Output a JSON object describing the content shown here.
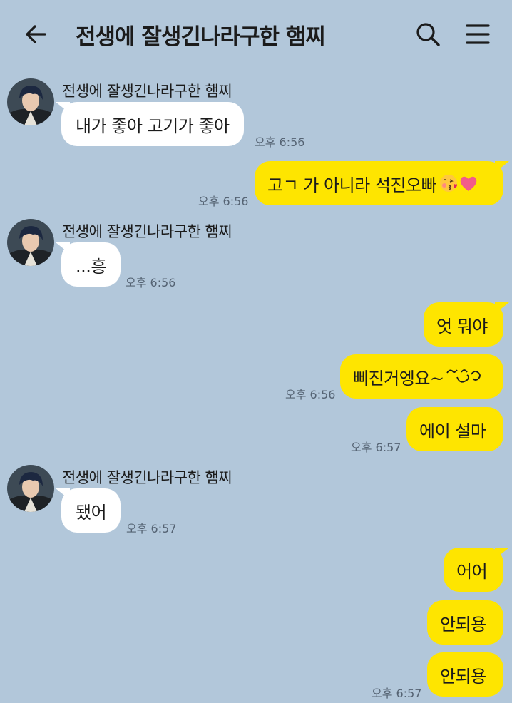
{
  "header": {
    "title": "전생에 잘생긴나라구한 햄찌",
    "back_icon": "back-arrow-icon",
    "search_icon": "search-icon",
    "menu_icon": "hamburger-menu-icon"
  },
  "colors": {
    "background": "#b2c7da",
    "incoming_bubble": "#ffffff",
    "outgoing_bubble": "#fee500",
    "time_text": "#556373"
  },
  "messages": [
    {
      "direction": "in",
      "sender": "전생에 잘생긴나라구한 햄찌",
      "text": "내가 좋아 고기가 좋아",
      "time": "오후 6:56"
    },
    {
      "direction": "out",
      "text": "고ㄱ 가 아니라 석진오빠",
      "emoji": [
        "kiss-face-icon",
        "pink-heart-icon"
      ],
      "time": "오후 6:56"
    },
    {
      "direction": "in",
      "sender": "전생에 잘생긴나라구한 햄찌",
      "text": "...흥",
      "time": "오후 6:56"
    },
    {
      "direction": "out",
      "text": "엇 뭐야",
      "time": ""
    },
    {
      "direction": "out",
      "text": "삐진거엥요~",
      "emoji": [
        "squiggle-face-icon"
      ],
      "time": "오후 6:56"
    },
    {
      "direction": "out",
      "text": "에이 설마",
      "time": "오후 6:57"
    },
    {
      "direction": "in",
      "sender": "전생에 잘생긴나라구한 햄찌",
      "text": "됐어",
      "time": "오후 6:57"
    },
    {
      "direction": "out",
      "text": "어어",
      "time": ""
    },
    {
      "direction": "out",
      "text": "안되용",
      "time": ""
    },
    {
      "direction": "out",
      "text": "안되용",
      "time": "오후 6:57"
    }
  ]
}
